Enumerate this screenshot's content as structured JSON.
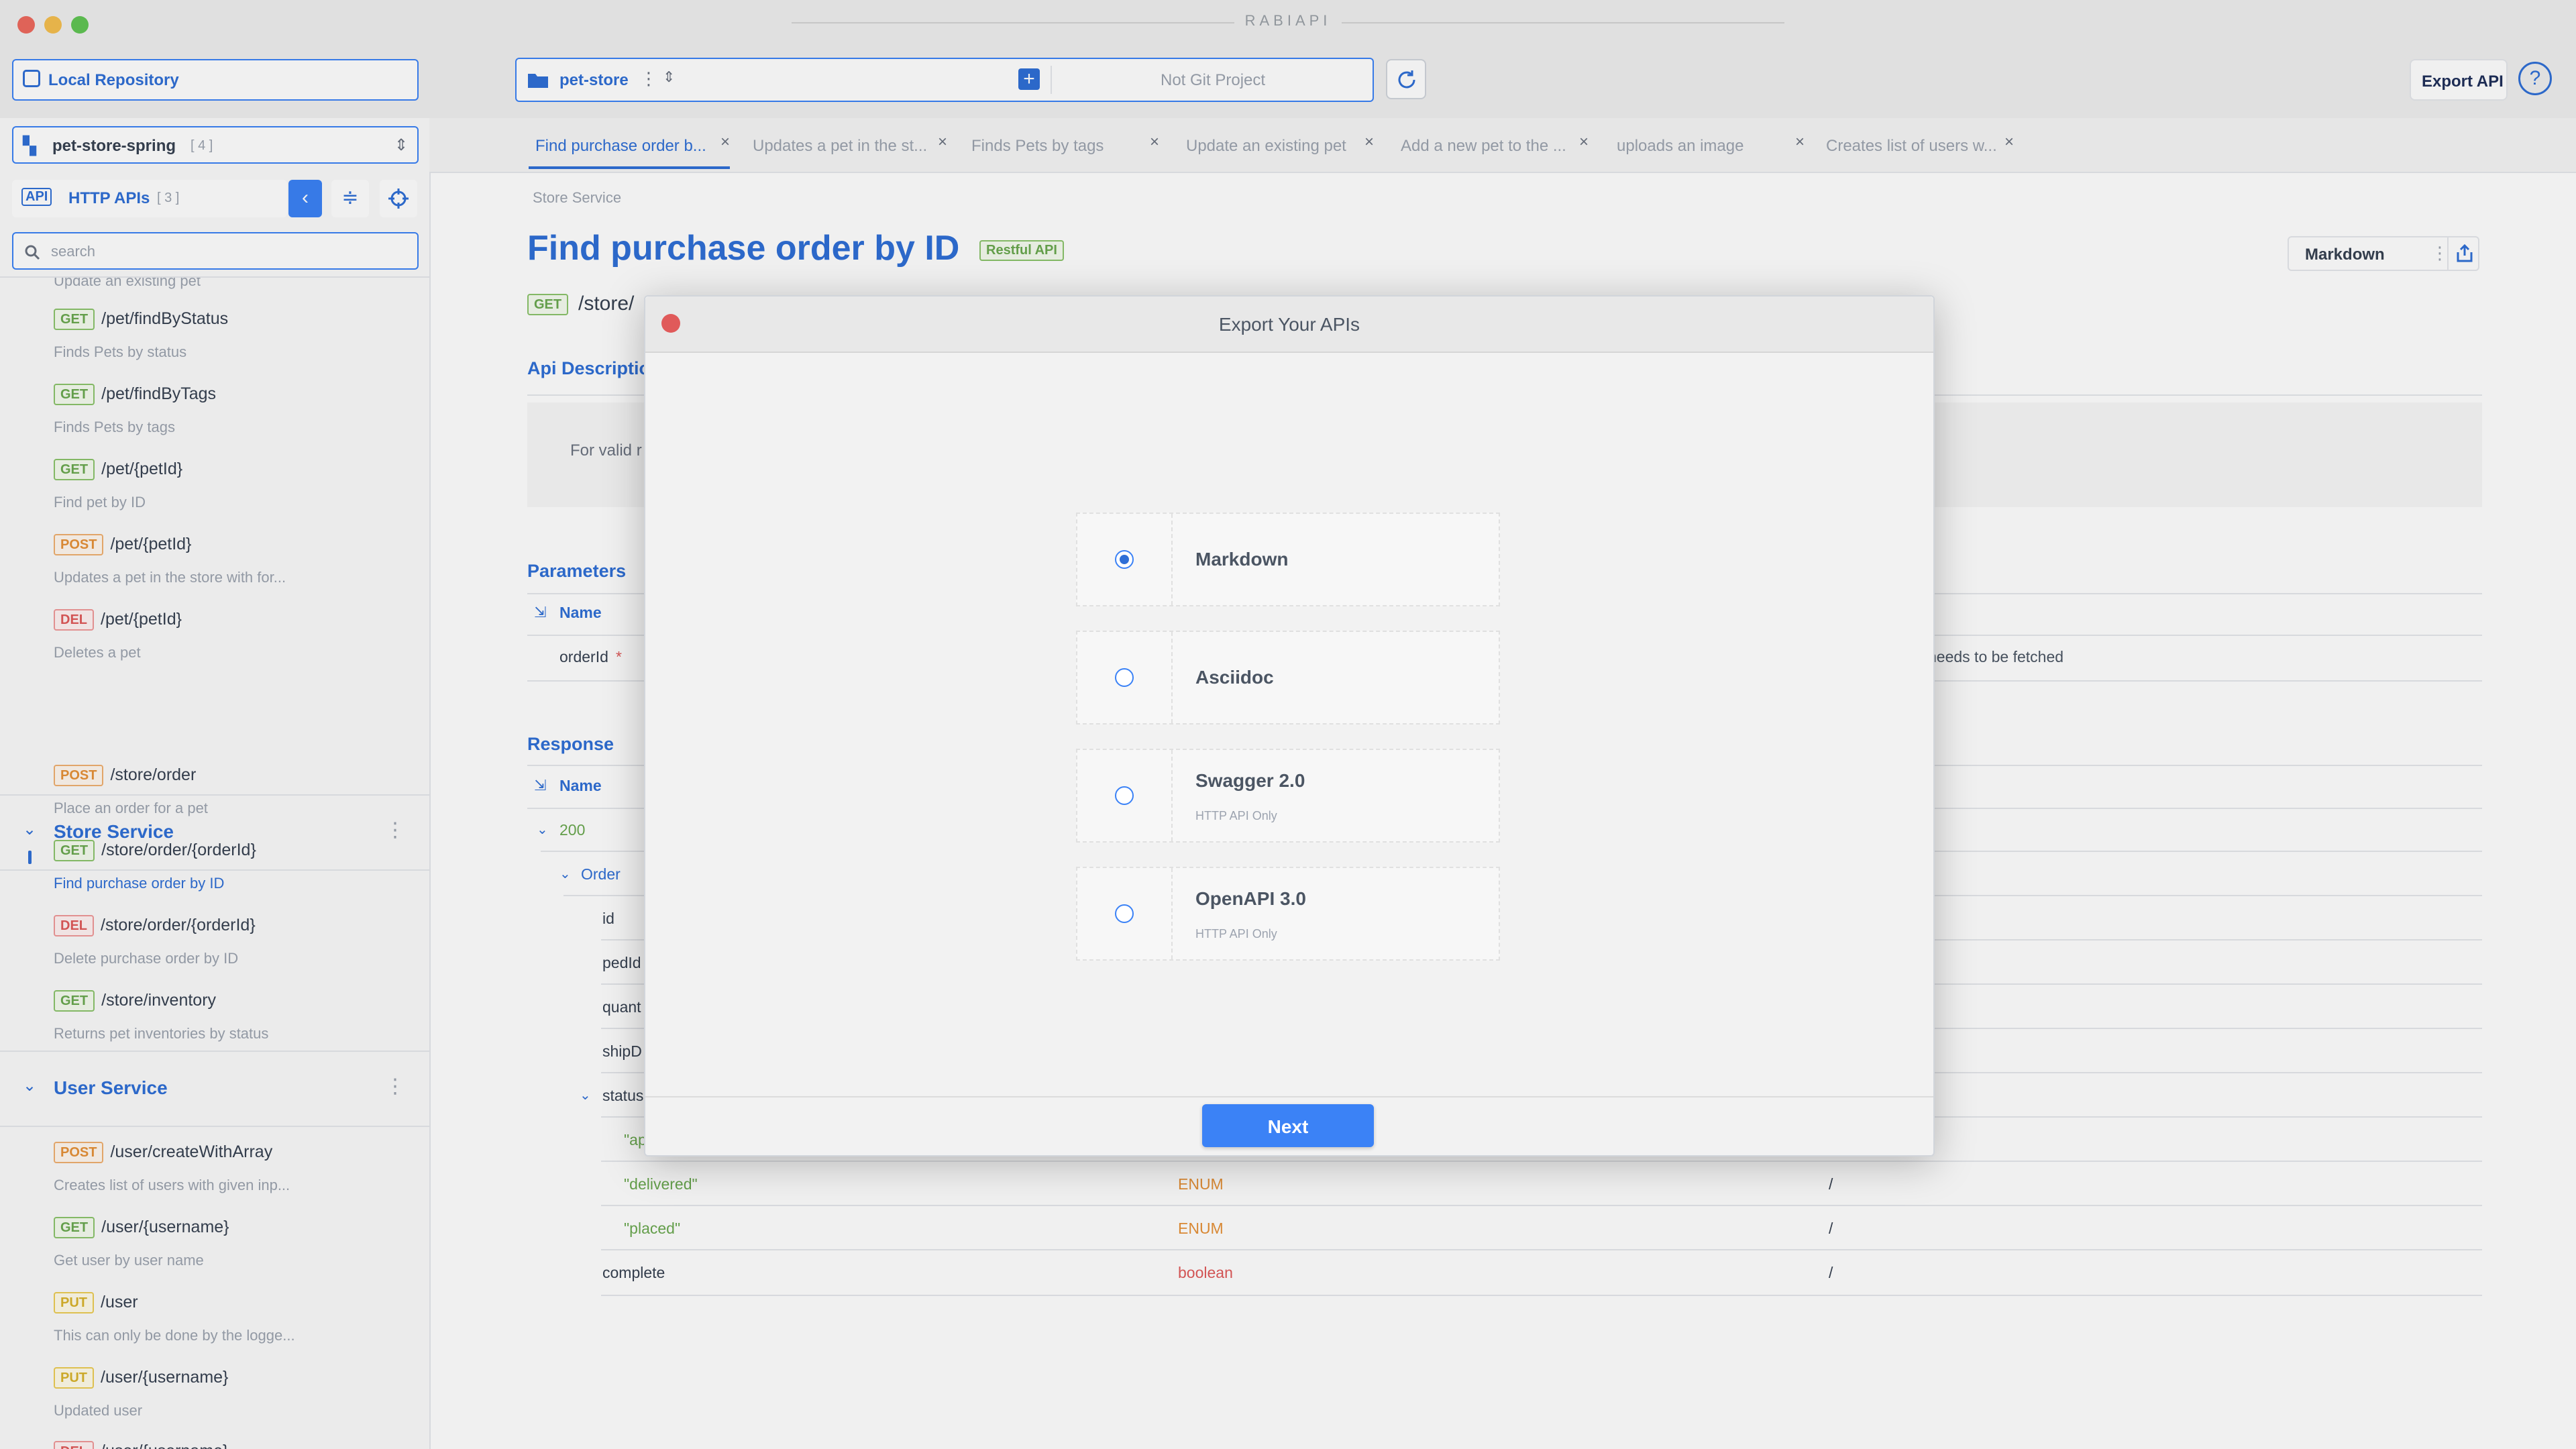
{
  "app": {
    "title": "RABIAPI"
  },
  "toolbar": {
    "repo_label": "Local Repository",
    "project_name": "pet-store",
    "git_status": "Not Git Project",
    "export_label": "Export API"
  },
  "sidebar": {
    "module_name": "pet-store-spring",
    "module_count": "[ 4 ]",
    "api_tag": "API",
    "api_title": "HTTP APIs",
    "api_count": "[ 3 ]",
    "search_placeholder": "search",
    "partial_top_desc": "Update an existing pet",
    "pet_items": [
      {
        "method": "GET",
        "path": "/pet/findByStatus",
        "desc": "Finds Pets by status"
      },
      {
        "method": "GET",
        "path": "/pet/findByTags",
        "desc": "Finds Pets by tags"
      },
      {
        "method": "GET",
        "path": "/pet/{petId}",
        "desc": "Find pet by ID"
      },
      {
        "method": "POST",
        "path": "/pet/{petId}",
        "desc": "Updates a pet in the store with for..."
      },
      {
        "method": "DEL",
        "path": "/pet/{petId}",
        "desc": "Deletes a pet"
      }
    ],
    "store_section": "Store Service",
    "store_items": [
      {
        "method": "POST",
        "path": "/store/order",
        "desc": "Place an order for a pet"
      },
      {
        "method": "GET",
        "path": "/store/order/{orderId}",
        "desc": "Find purchase order by ID"
      },
      {
        "method": "DEL",
        "path": "/store/order/{orderId}",
        "desc": "Delete purchase order by ID"
      },
      {
        "method": "GET",
        "path": "/store/inventory",
        "desc": "Returns pet inventories by status"
      }
    ],
    "user_section": "User Service",
    "user_items": [
      {
        "method": "POST",
        "path": "/user/createWithArray",
        "desc": "Creates list of users with given inp..."
      },
      {
        "method": "GET",
        "path": "/user/{username}",
        "desc": "Get user by user name"
      },
      {
        "method": "PUT",
        "path": "/user",
        "desc": "This can only be done by the logge..."
      },
      {
        "method": "PUT",
        "path": "/user/{username}",
        "desc": "Updated user"
      },
      {
        "method": "DEL",
        "path": "/user/{username}",
        "desc": ""
      }
    ]
  },
  "tabs": [
    {
      "label": "Find purchase order b...",
      "active": true
    },
    {
      "label": "Updates a pet in the st...",
      "active": false
    },
    {
      "label": "Finds Pets by tags",
      "active": false
    },
    {
      "label": "Update an existing pet",
      "active": false
    },
    {
      "label": "Add a new pet to the ...",
      "active": false
    },
    {
      "label": "uploads an image",
      "active": false
    },
    {
      "label": "Creates list of users w...",
      "active": false
    }
  ],
  "detail": {
    "breadcrumb": "Store Service",
    "title": "Find purchase order by ID",
    "kind_badge": "Restful API",
    "format_select": "Markdown",
    "method": "GET",
    "path": "/store/",
    "desc_heading": "Api Description",
    "desc_text": "For valid r",
    "params_heading": "Parameters",
    "name_col": "Name",
    "param_name": "orderId",
    "param_required": "*",
    "param_desc": "needs to be fetched",
    "response_heading": "Response",
    "status_code": "200",
    "order_label": "Order",
    "fields": [
      "id",
      "pedId",
      "quant",
      "shipD"
    ],
    "status_field": "status",
    "enum_partial": "\"ap",
    "rows": [
      {
        "name": "\"delivered\"",
        "type": "ENUM",
        "desc": "/"
      },
      {
        "name": "\"placed\"",
        "type": "ENUM",
        "desc": "/"
      },
      {
        "name": "complete",
        "type": "boolean",
        "desc": "/"
      }
    ]
  },
  "modal": {
    "title": "Export Your APIs",
    "options": [
      {
        "label": "Markdown",
        "sub": "",
        "selected": true
      },
      {
        "label": "Asciidoc",
        "sub": "",
        "selected": false
      },
      {
        "label": "Swagger 2.0",
        "sub": "HTTP API Only",
        "selected": false
      },
      {
        "label": "OpenAPI 3.0",
        "sub": "HTTP API Only",
        "selected": false
      }
    ],
    "next_label": "Next"
  },
  "colors": {
    "accent": "#2f6fd6",
    "get": "#6aa84f",
    "post": "#e69138",
    "delete": "#e05a5a",
    "put": "#d9b32b"
  }
}
